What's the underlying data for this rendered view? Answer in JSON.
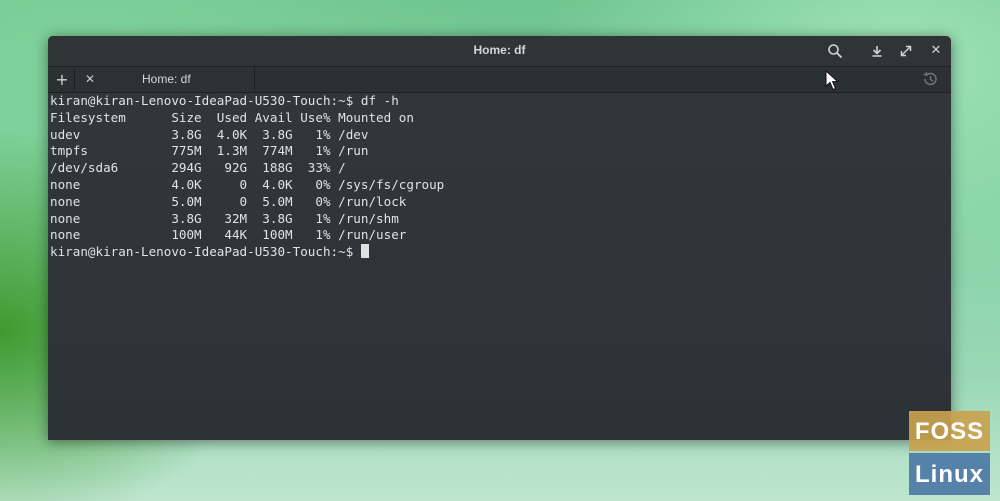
{
  "window": {
    "title": "Home: df",
    "controls": {
      "search_icon": "search-icon",
      "download_icon": "download-icon",
      "maximize_icon": "maximize-icon",
      "close_glyph": "✕"
    }
  },
  "tabs": {
    "add_glyph": "+",
    "items": [
      {
        "label": "Home: df",
        "close_glyph": "✕"
      }
    ],
    "history_icon": "history-icon"
  },
  "terminal": {
    "lines": [
      "kiran@kiran-Lenovo-IdeaPad-U530-Touch:~$ df -h",
      "Filesystem      Size  Used Avail Use% Mounted on",
      "udev            3.8G  4.0K  3.8G   1% /dev",
      "tmpfs           775M  1.3M  774M   1% /run",
      "/dev/sda6       294G   92G  188G  33% /",
      "none            4.0K     0  4.0K   0% /sys/fs/cgroup",
      "none            5.0M     0  5.0M   0% /run/lock",
      "none            3.8G   32M  3.8G   1% /run/shm",
      "none            100M   44K  100M   1% /run/user"
    ],
    "prompt": "kiran@kiran-Lenovo-IdeaPad-U530-Touch:~$ "
  },
  "watermark": {
    "top": "FOSS",
    "bottom": "Linux"
  }
}
